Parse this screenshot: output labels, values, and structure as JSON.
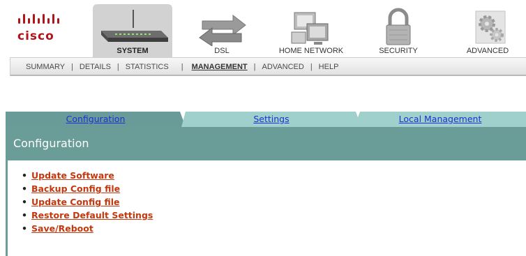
{
  "brand": {
    "logo_text": "cisco",
    "logo_color": "#b0151b"
  },
  "nav_tabs": [
    {
      "label": "SYSTEM",
      "icon": "router-icon",
      "selected": true
    },
    {
      "label": "DSL",
      "icon": "transfer-arrows-icon",
      "selected": false
    },
    {
      "label": "HOME NETWORK",
      "icon": "computers-icon",
      "selected": false
    },
    {
      "label": "SECURITY",
      "icon": "padlock-icon",
      "selected": false
    },
    {
      "label": "ADVANCED",
      "icon": "gears-icon",
      "selected": false
    }
  ],
  "subnav": [
    {
      "label": "SUMMARY",
      "active": false
    },
    {
      "label": "DETAILS",
      "active": false
    },
    {
      "label": "STATISTICS",
      "active": false
    },
    {
      "label": "MANAGEMENT",
      "active": true
    },
    {
      "label": "ADVANCED",
      "active": false
    },
    {
      "label": "HELP",
      "active": false
    }
  ],
  "content_tabs": [
    {
      "label": "Configuration",
      "active": true
    },
    {
      "label": "Settings",
      "active": false
    },
    {
      "label": "Local Management",
      "active": false
    }
  ],
  "panel": {
    "title": "Configuration",
    "links": [
      "Update Software",
      "Backup Config file",
      "Update Config file",
      "Restore Default Settings",
      "Save/Reboot"
    ]
  },
  "colors": {
    "panel_header": "#6a9c98",
    "inactive_tab": "#9fd0cb",
    "link": "#c4380e",
    "tab_link": "#1f2fd6"
  }
}
